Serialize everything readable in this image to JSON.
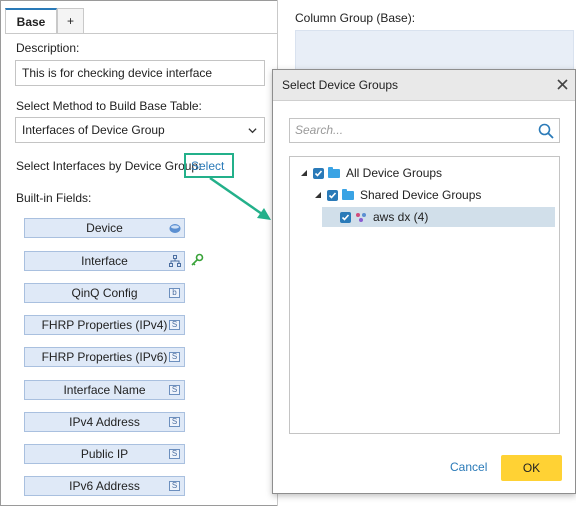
{
  "tabs": {
    "base": "Base",
    "add": "+"
  },
  "form": {
    "description_label": "Description:",
    "description_value": "This is for checking device interface",
    "method_label": "Select Method to Build Base Table:",
    "method_value": "Interfaces of Device Group",
    "select_interfaces_label": "Select Interfaces by Device Group:",
    "select_link": "Select",
    "builtin_label": "Built-in Fields:"
  },
  "fields": [
    {
      "label": "Device",
      "icon": "db-icon"
    },
    {
      "label": "Interface",
      "icon": "network-icon"
    },
    {
      "label": "QinQ Config",
      "icon": "b"
    },
    {
      "label": "FHRP Properties (IPv4)",
      "icon": "S"
    },
    {
      "label": "FHRP Properties (IPv6)",
      "icon": "S"
    },
    {
      "label": "Interface Name",
      "icon": "S"
    },
    {
      "label": "IPv4 Address",
      "icon": "S"
    },
    {
      "label": "Public IP",
      "icon": "S"
    },
    {
      "label": "IPv6 Address",
      "icon": "S"
    }
  ],
  "column_group": {
    "label": "Column Group (Base):"
  },
  "dialog": {
    "title": "Select Device Groups",
    "search_placeholder": "Search...",
    "tree": {
      "root": "All Device Groups",
      "child": "Shared Device Groups",
      "leaf": "aws dx (4)"
    },
    "cancel": "Cancel",
    "ok": "OK"
  },
  "colors": {
    "accent": "#2a7ab8",
    "ok_button": "#ffd234",
    "callout": "#23b08a",
    "field_bg": "#dfe9f7"
  }
}
